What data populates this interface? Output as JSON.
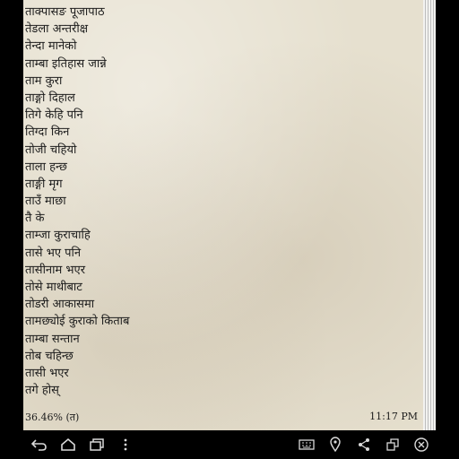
{
  "reader": {
    "lines": [
      "ताक्पासङ पूजापाठ",
      "तेडला अन्तरीक्ष",
      "तेन्दा मानेको",
      "ताम्बा इतिहास जान्ने",
      "ताम  कुरा",
      "ताङ्गो दिहाल",
      "तिगे केहि पनि",
      "तिग्दा किन",
      "तोजी चहियो",
      "ताला हन्छ",
      "ताङ्गी मृग",
      "ताउँ माछा",
      "तै के",
      "ताम्जा कुराचाहि",
      "तासे भए पनि",
      "तासीनाम भएर",
      "तोसे माथीबाट",
      "तोडरी आकासमा",
      "तामछ्योई कुराको किताब",
      "ताम्बा सन्तान",
      "तोब चहिन्छ",
      "तासी भएर",
      "तगे होस्"
    ],
    "progress": "36.46% (त)",
    "time": "11:17 PM"
  },
  "navbar": {
    "left_icons": [
      "back-icon",
      "home-icon",
      "recent-apps-icon",
      "overflow-menu-icon"
    ],
    "right_icons": [
      "keyboard-icon",
      "location-pin-icon",
      "share-icon",
      "window-icon",
      "close-circle-icon"
    ]
  },
  "colors": {
    "page_bg": "#e6e0cf",
    "text": "#1c1c1c",
    "navbar_bg": "#000000",
    "icon": "#d9d9d9"
  }
}
